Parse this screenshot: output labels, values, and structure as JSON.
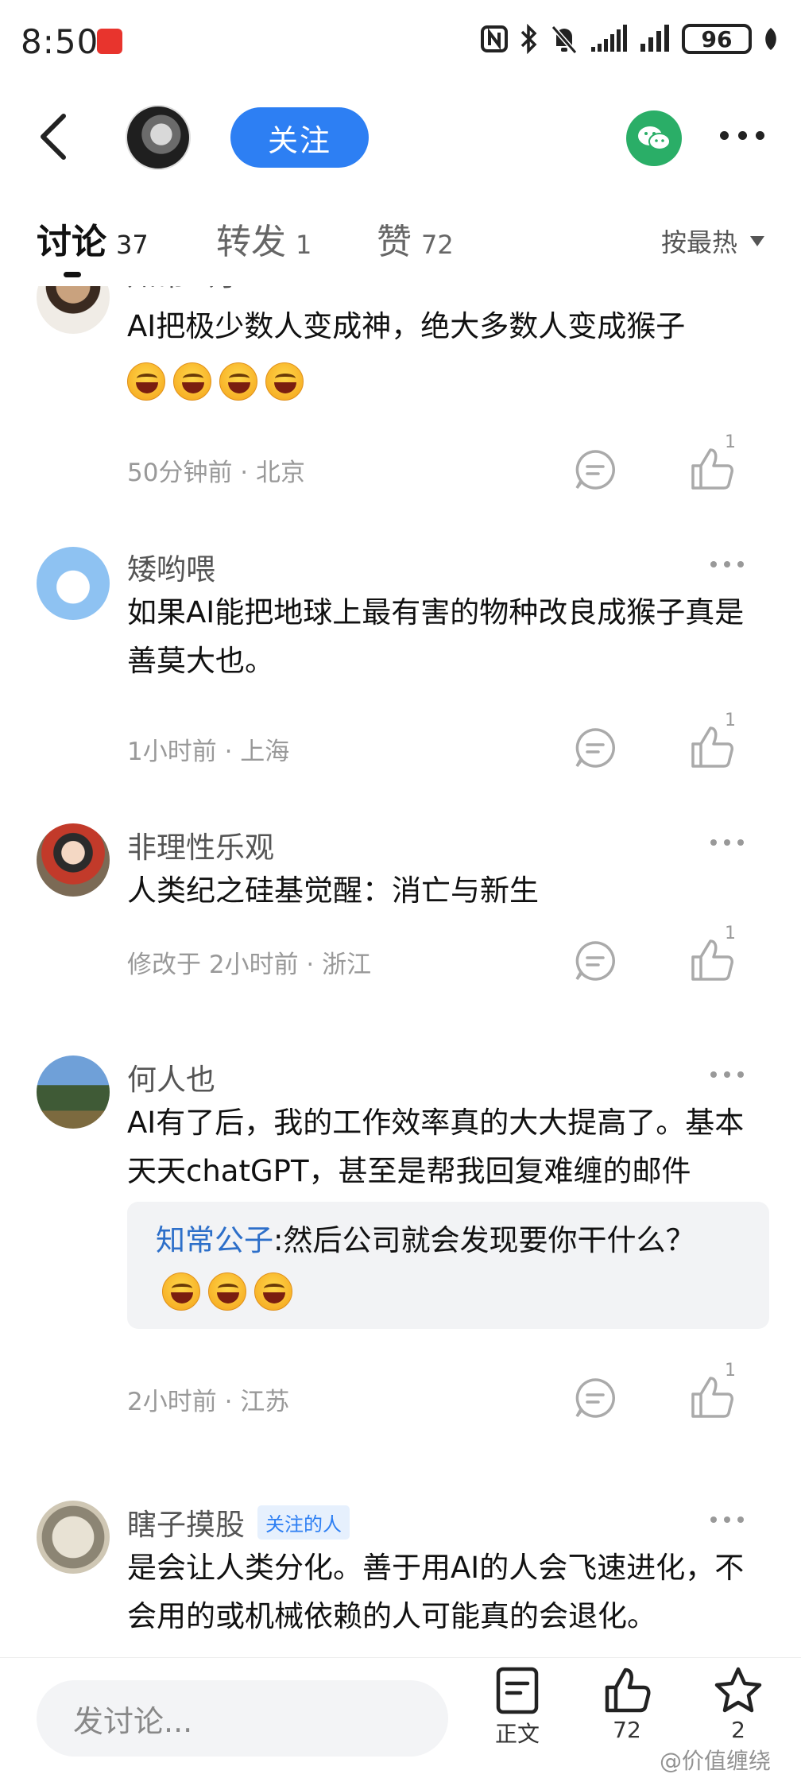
{
  "status_bar": {
    "time": "8:50",
    "battery": "96"
  },
  "top_nav": {
    "follow_label": "关注"
  },
  "tabs": [
    {
      "label": "讨论",
      "count": "37"
    },
    {
      "label": "转发",
      "count": "1"
    },
    {
      "label": "赞",
      "count": "72"
    }
  ],
  "sort": {
    "label": "按最热"
  },
  "comments": [
    {
      "name": "知常公子",
      "text": "AI把极少数人变成神，绝大多数人变成猴子",
      "meta": "50分钟前 · 北京",
      "likes": "1"
    },
    {
      "name": "矮哟喂",
      "text": "如果AI能把地球上最有害的物种改良成猴子真是善莫大也。",
      "meta": "1小时前 · 上海",
      "likes": "1"
    },
    {
      "name": "非理性乐观",
      "text": "人类纪之硅基觉醒：消亡与新生",
      "meta": "修改于 2小时前 · 浙江",
      "likes": "1"
    },
    {
      "name": "何人也",
      "text": "AI有了后，我的工作效率真的大大提高了。基本天天chatGPT，甚至是帮我回复难缠的邮件",
      "reply_author": "知常公子",
      "reply_text": ":然后公司就会发现要你干什么？",
      "meta": "2小时前 · 江苏",
      "likes": "1"
    },
    {
      "name": "瞎子摸股",
      "tag": "关注的人",
      "text": "是会让人类分化。善于用AI的人会飞速进化，不会用的或机械依赖的人可能真的会退化。"
    }
  ],
  "bottom_bar": {
    "input_placeholder": "发讨论...",
    "article_label": "正文",
    "like_count": "72",
    "favorite_count": "2",
    "watermark": "@价值缠绕"
  }
}
